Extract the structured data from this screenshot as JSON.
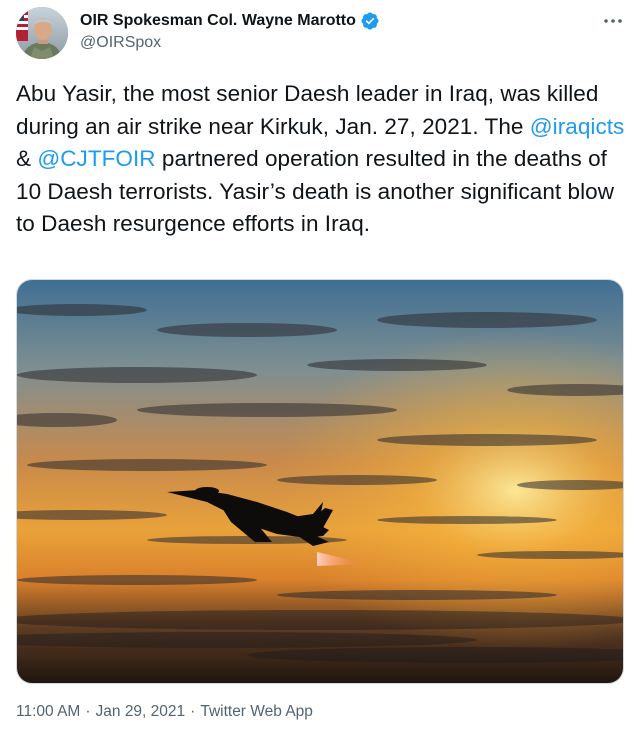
{
  "author": {
    "display_name": "OIR Spokesman Col. Wayne Marotto",
    "handle": "@OIRSpox",
    "verified_icon": "verified-badge-icon",
    "avatar_icon": "profile-avatar"
  },
  "more_icon": "more-horizontal-icon",
  "tweet": {
    "text_part1": "Abu Yasir, the most senior Daesh leader in Iraq, was killed during an air strike near Kirkuk, Jan. 27, 2021. The ",
    "mention1": "@iraqicts",
    "text_part2": " & ",
    "mention2": "@CJTFOIR",
    "text_part3": " partnered operation resulted in the deaths of 10 Daesh terrorists. Yasir’s death is another significant blow to Daesh resurgence efforts in Iraq."
  },
  "media": {
    "icon": "fighter-jet-sunset-photo"
  },
  "meta": {
    "time": "11:00 AM",
    "separator": "·",
    "date": "Jan 29, 2021",
    "source": "Twitter Web App"
  },
  "colors": {
    "link": "#1d9bf0",
    "verified": "#1d9bf0",
    "secondary_text": "#536471"
  }
}
